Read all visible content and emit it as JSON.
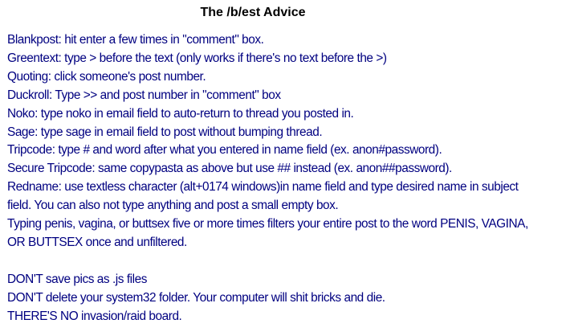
{
  "title": "The /b/est Advice",
  "tips": [
    "Blankpost: hit enter a few times in \"comment\" box.",
    "Greentext: type > before the text (only works if there's no text before the >)",
    "Quoting: click someone's post number.",
    "Duckroll: Type >> and post number in \"comment\" box",
    "Noko: type noko in email field to auto-return to thread you posted in.",
    "Sage: type sage in email field to post without bumping thread.",
    "Tripcode: type # and word after what you entered in name field (ex. anon#password).",
    "Secure Tripcode: same copypasta as above but use ## instead (ex. anon##password).",
    "Redname: use textless character (alt+0174 windows)in name field and type desired name in subject",
    "field. You can also not type anything and post a small empty box.",
    "Typing penis, vagina, or buttsex five or more times filters your entire post to the word PENIS, VAGINA,",
    "OR BUTTSEX once and unfiltered."
  ],
  "warnings": [
    "DON'T save pics as .js files",
    "DON'T delete your system32 folder. Your computer will shit bricks and die.",
    "THERE'S NO invasion/raid board."
  ]
}
